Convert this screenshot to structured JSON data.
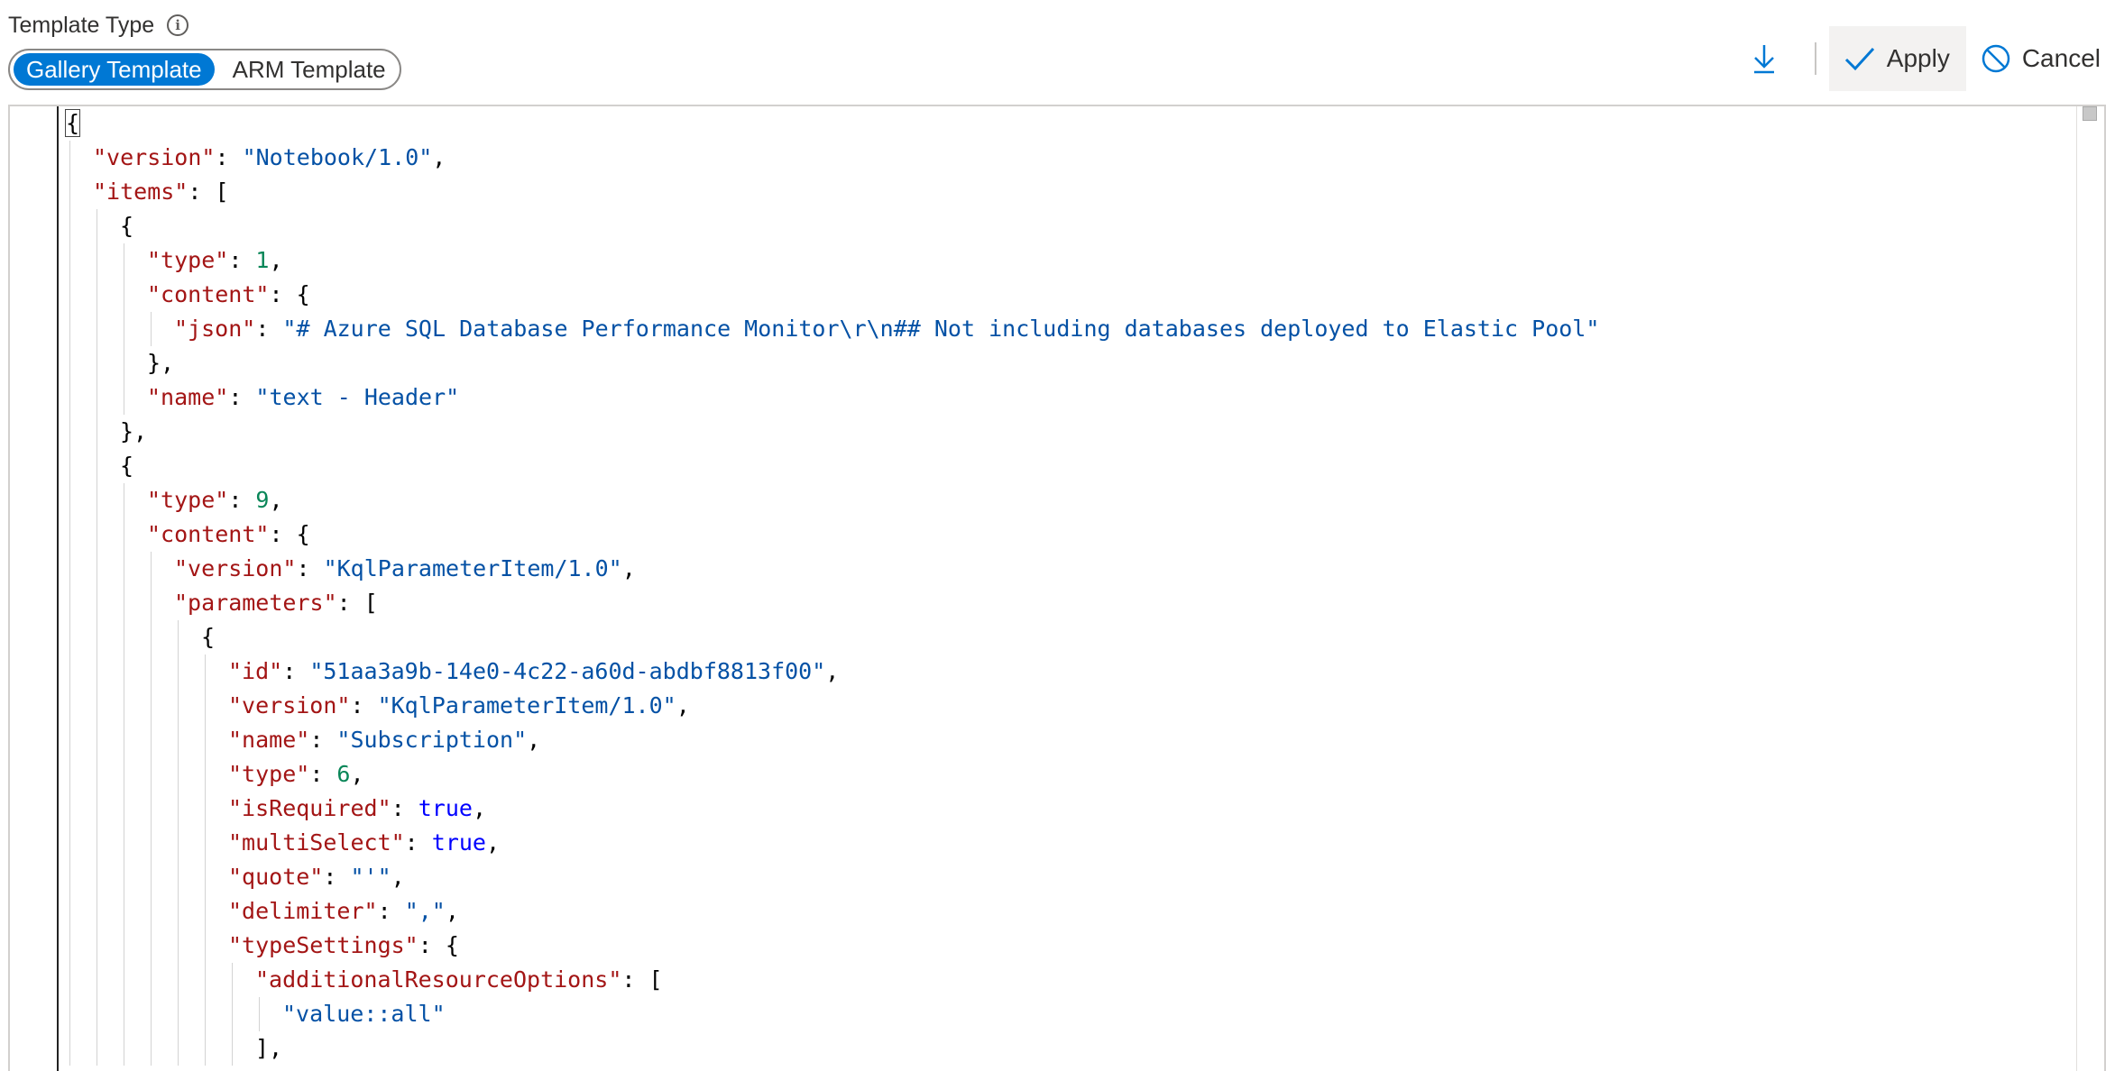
{
  "header": {
    "label": "Template Type",
    "info_icon": "info-icon"
  },
  "toggle": {
    "options": [
      "Gallery Template",
      "ARM Template"
    ],
    "selected": "Gallery Template"
  },
  "toolbar": {
    "download_icon": "download-icon",
    "apply_label": "Apply",
    "cancel_label": "Cancel"
  },
  "colors": {
    "accent": "#0078d4",
    "json_key": "#a31515",
    "json_string": "#0451a5",
    "json_number": "#098658",
    "json_boolean": "#0000ff"
  },
  "editor": {
    "lines": [
      {
        "indent": 0,
        "tokens": [
          [
            "p",
            "{"
          ]
        ]
      },
      {
        "indent": 1,
        "tokens": [
          [
            "k",
            "\"version\""
          ],
          [
            "p",
            ": "
          ],
          [
            "s",
            "\"Notebook/1.0\""
          ],
          [
            "p",
            ","
          ]
        ]
      },
      {
        "indent": 1,
        "tokens": [
          [
            "k",
            "\"items\""
          ],
          [
            "p",
            ": ["
          ]
        ]
      },
      {
        "indent": 2,
        "tokens": [
          [
            "p",
            "{"
          ]
        ]
      },
      {
        "indent": 3,
        "tokens": [
          [
            "k",
            "\"type\""
          ],
          [
            "p",
            ": "
          ],
          [
            "n",
            "1"
          ],
          [
            "p",
            ","
          ]
        ]
      },
      {
        "indent": 3,
        "tokens": [
          [
            "k",
            "\"content\""
          ],
          [
            "p",
            ": {"
          ]
        ]
      },
      {
        "indent": 4,
        "tokens": [
          [
            "k",
            "\"json\""
          ],
          [
            "p",
            ": "
          ],
          [
            "s",
            "\"# Azure SQL Database Performance Monitor\\r\\n## Not including databases deployed to Elastic Pool\""
          ]
        ]
      },
      {
        "indent": 3,
        "tokens": [
          [
            "p",
            "},"
          ]
        ]
      },
      {
        "indent": 3,
        "tokens": [
          [
            "k",
            "\"name\""
          ],
          [
            "p",
            ": "
          ],
          [
            "s",
            "\"text - Header\""
          ]
        ]
      },
      {
        "indent": 2,
        "tokens": [
          [
            "p",
            "},"
          ]
        ]
      },
      {
        "indent": 2,
        "tokens": [
          [
            "p",
            "{"
          ]
        ]
      },
      {
        "indent": 3,
        "tokens": [
          [
            "k",
            "\"type\""
          ],
          [
            "p",
            ": "
          ],
          [
            "n",
            "9"
          ],
          [
            "p",
            ","
          ]
        ]
      },
      {
        "indent": 3,
        "tokens": [
          [
            "k",
            "\"content\""
          ],
          [
            "p",
            ": {"
          ]
        ]
      },
      {
        "indent": 4,
        "tokens": [
          [
            "k",
            "\"version\""
          ],
          [
            "p",
            ": "
          ],
          [
            "s",
            "\"KqlParameterItem/1.0\""
          ],
          [
            "p",
            ","
          ]
        ]
      },
      {
        "indent": 4,
        "tokens": [
          [
            "k",
            "\"parameters\""
          ],
          [
            "p",
            ": ["
          ]
        ]
      },
      {
        "indent": 5,
        "tokens": [
          [
            "p",
            "{"
          ]
        ]
      },
      {
        "indent": 6,
        "tokens": [
          [
            "k",
            "\"id\""
          ],
          [
            "p",
            ": "
          ],
          [
            "s",
            "\"51aa3a9b-14e0-4c22-a60d-abdbf8813f00\""
          ],
          [
            "p",
            ","
          ]
        ]
      },
      {
        "indent": 6,
        "tokens": [
          [
            "k",
            "\"version\""
          ],
          [
            "p",
            ": "
          ],
          [
            "s",
            "\"KqlParameterItem/1.0\""
          ],
          [
            "p",
            ","
          ]
        ]
      },
      {
        "indent": 6,
        "tokens": [
          [
            "k",
            "\"name\""
          ],
          [
            "p",
            ": "
          ],
          [
            "s",
            "\"Subscription\""
          ],
          [
            "p",
            ","
          ]
        ]
      },
      {
        "indent": 6,
        "tokens": [
          [
            "k",
            "\"type\""
          ],
          [
            "p",
            ": "
          ],
          [
            "n",
            "6"
          ],
          [
            "p",
            ","
          ]
        ]
      },
      {
        "indent": 6,
        "tokens": [
          [
            "k",
            "\"isRequired\""
          ],
          [
            "p",
            ": "
          ],
          [
            "b",
            "true"
          ],
          [
            "p",
            ","
          ]
        ]
      },
      {
        "indent": 6,
        "tokens": [
          [
            "k",
            "\"multiSelect\""
          ],
          [
            "p",
            ": "
          ],
          [
            "b",
            "true"
          ],
          [
            "p",
            ","
          ]
        ]
      },
      {
        "indent": 6,
        "tokens": [
          [
            "k",
            "\"quote\""
          ],
          [
            "p",
            ": "
          ],
          [
            "s",
            "\"'\""
          ],
          [
            "p",
            ","
          ]
        ]
      },
      {
        "indent": 6,
        "tokens": [
          [
            "k",
            "\"delimiter\""
          ],
          [
            "p",
            ": "
          ],
          [
            "s",
            "\",\""
          ],
          [
            "p",
            ","
          ]
        ]
      },
      {
        "indent": 6,
        "tokens": [
          [
            "k",
            "\"typeSettings\""
          ],
          [
            "p",
            ": {"
          ]
        ]
      },
      {
        "indent": 7,
        "tokens": [
          [
            "k",
            "\"additionalResourceOptions\""
          ],
          [
            "p",
            ": ["
          ]
        ]
      },
      {
        "indent": 8,
        "tokens": [
          [
            "s",
            "\"value::all\""
          ]
        ]
      },
      {
        "indent": 7,
        "tokens": [
          [
            "p",
            "],"
          ]
        ]
      }
    ]
  }
}
